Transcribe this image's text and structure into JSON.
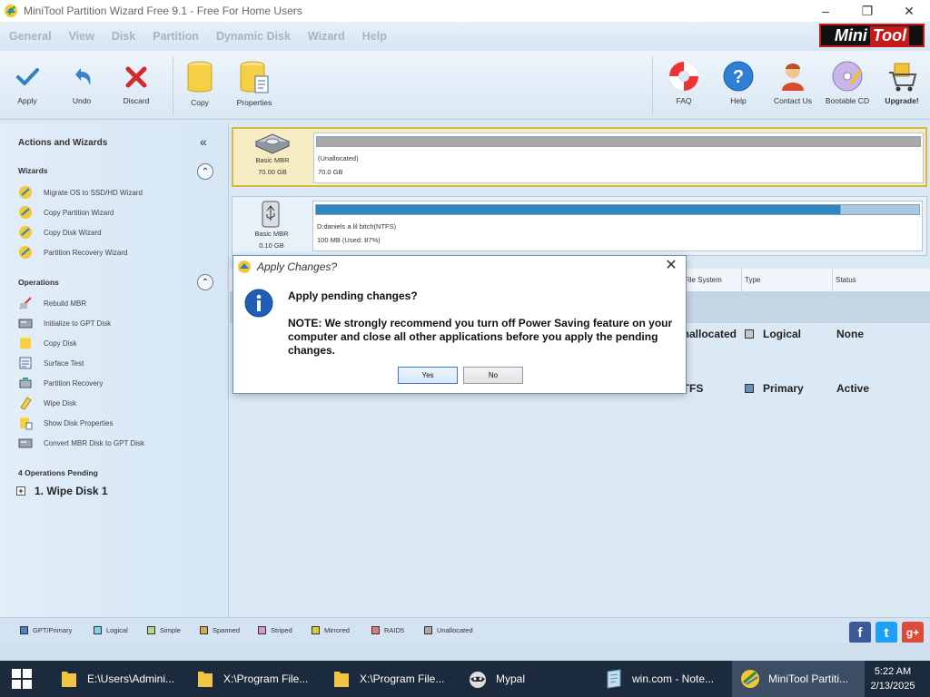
{
  "window": {
    "title": "MiniTool Partition Wizard Free 9.1 - Free For Home Users",
    "controls": [
      "–",
      "❐",
      "✕"
    ]
  },
  "menu": [
    "General",
    "View",
    "Disk",
    "Partition",
    "Dynamic Disk",
    "Wizard",
    "Help"
  ],
  "logo": {
    "left": "Mini",
    "right": "Tool"
  },
  "toolbar": {
    "apply": "Apply",
    "undo": "Undo",
    "discard": "Discard",
    "copy": "Copy",
    "properties": "Properties",
    "faq": "FAQ",
    "help": "Help",
    "contact": "Contact Us",
    "bootable": "Bootable CD",
    "upgrade": "Upgrade!"
  },
  "sidebar": {
    "header": "Actions and Wizards",
    "collapse_glyph": "«",
    "wizards_title": "Wizards",
    "wizards": [
      "Migrate OS to SSD/HD Wizard",
      "Copy Partition Wizard",
      "Copy Disk Wizard",
      "Partition Recovery Wizard"
    ],
    "operations_title": "Operations",
    "operations": [
      "Rebuild MBR",
      "Initialize to GPT Disk",
      "Copy Disk",
      "Surface Test",
      "Partition Recovery",
      "Wipe Disk",
      "Show Disk Properties",
      "Convert MBR Disk to GPT Disk"
    ],
    "pending_title": "4 Operations Pending",
    "pending_items": [
      "1. Wipe Disk 1"
    ]
  },
  "disks": [
    {
      "type": "Basic MBR",
      "size": "70.00 GB",
      "partition_name": "(Unallocated)",
      "partition_size": "70.0 GB",
      "bar_color": "#a9a9a9",
      "used_fraction": 1.0
    },
    {
      "type": "Basic MBR",
      "size": "0.10 GB",
      "partition_name": "D:daniels a lil bitch(NTFS)",
      "partition_size": "100 MB (Used: 87%)",
      "bar_color": "#2f86c0",
      "used_fraction": 0.87
    }
  ],
  "table": {
    "headers": [
      "File System",
      "Type",
      "Status"
    ],
    "rows": [
      {
        "fs": "Unallocated",
        "type": "Logical",
        "status": "None",
        "swatch": "#c8c8c8"
      },
      {
        "fs": "NTFS",
        "type": "Primary",
        "status": "Active",
        "swatch": "#6b8fb6"
      }
    ]
  },
  "legend": [
    {
      "label": "GPT/Primary",
      "color": "#4f7fbf"
    },
    {
      "label": "Logical",
      "color": "#7fd0e8"
    },
    {
      "label": "Simple",
      "color": "#b9d58a"
    },
    {
      "label": "Spanned",
      "color": "#d6a95a"
    },
    {
      "label": "Striped",
      "color": "#d29ad6"
    },
    {
      "label": "Mirrored",
      "color": "#d6cf3a"
    },
    {
      "label": "RAID5",
      "color": "#e07a7a"
    },
    {
      "label": "Unallocated",
      "color": "#a9a9a9"
    }
  ],
  "social": {
    "facebook": "f",
    "twitter": "t",
    "google": "g+"
  },
  "dialog": {
    "title": "Apply Changes?",
    "question": "Apply pending changes?",
    "note": "NOTE: We strongly recommend you turn off Power Saving feature on your computer and close all other applications before you apply the pending changes.",
    "yes": "Yes",
    "no": "No",
    "close": "✕"
  },
  "taskbar": {
    "tasks": [
      {
        "label": "E:\\Users\\Admini...",
        "icon": "folder-icon"
      },
      {
        "label": "X:\\Program File...",
        "icon": "folder-icon"
      },
      {
        "label": "X:\\Program File...",
        "icon": "folder-icon"
      },
      {
        "label": "Mypal",
        "icon": "raccoon-icon"
      },
      {
        "label": "win.com - Note...",
        "icon": "notepad-icon"
      },
      {
        "label": "MiniTool Partiti...",
        "icon": "minitool-icon"
      }
    ],
    "time": "5:22 AM",
    "date": "2/13/2025"
  }
}
